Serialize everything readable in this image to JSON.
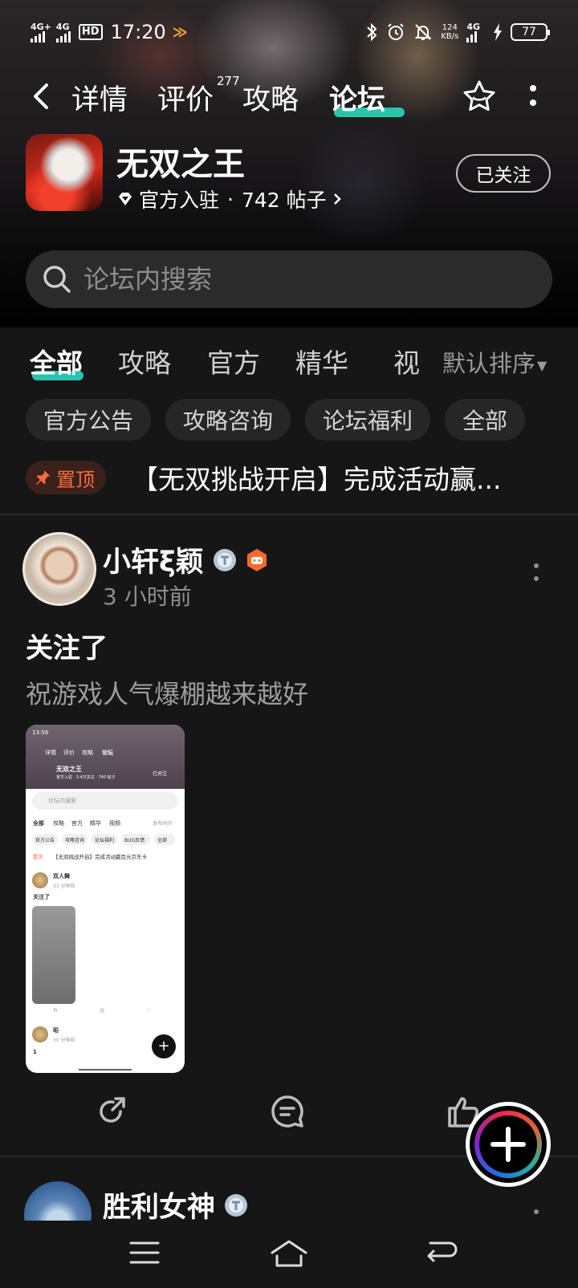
{
  "status_bar": {
    "signal1": "4G+",
    "signal2": "4G",
    "hd": "HD",
    "time": "17:20",
    "speed_value": "124",
    "speed_unit": "KB/s",
    "network": "4G",
    "battery": "77"
  },
  "nav": {
    "tabs": [
      {
        "label": "详情"
      },
      {
        "label": "评价",
        "badge": "277"
      },
      {
        "label": "攻略"
      },
      {
        "label": "论坛",
        "active": true
      }
    ],
    "accent_color": "#28c5ad"
  },
  "game": {
    "title": "无双之王",
    "official_label": "官方入驻",
    "separator": "·",
    "post_count": "742 帖子",
    "follow_label": "已关注"
  },
  "search": {
    "placeholder": "论坛内搜索"
  },
  "categories": {
    "tabs": [
      "全部",
      "攻略",
      "官方",
      "精华",
      "视频"
    ],
    "active": "全部",
    "sort_label": "默认排序",
    "chips": [
      "官方公告",
      "攻略咨询",
      "论坛福利",
      "全部"
    ]
  },
  "pinned": {
    "badge": "置顶",
    "title": "【无双挑战开启】完成活动赢..."
  },
  "posts": [
    {
      "author": "小轩ξ颖",
      "time": "3 小时前",
      "title": "关注了",
      "body": "祝游戏人气爆棚越来越好",
      "embedded_screenshot": {
        "time": "13:56",
        "nav_tabs": [
          "详情",
          "评价",
          "攻略",
          "论坛"
        ],
        "game_title": "无双之王",
        "game_meta": "官方入驻 · 3.4万关注 · 740 帖子",
        "follow": "已关注",
        "search": "论坛内搜索",
        "tabs": [
          "全部",
          "攻略",
          "官方",
          "精华",
          "视频"
        ],
        "sort": "发布时间",
        "chips": [
          "官方公告",
          "攻略咨询",
          "论坛福利",
          "BUG反馈",
          "全部"
        ],
        "pin_badge": "置顶",
        "pin_title": "【无双挑战开启】完成活动赢百元京东卡",
        "post_author": "双人舞",
        "post_time": "33 分钟前",
        "post_title": "关注了",
        "post2_author": "昭",
        "post2_time": "30 分钟前",
        "post2_title": "1"
      }
    },
    {
      "author": "胜利女神"
    }
  ]
}
